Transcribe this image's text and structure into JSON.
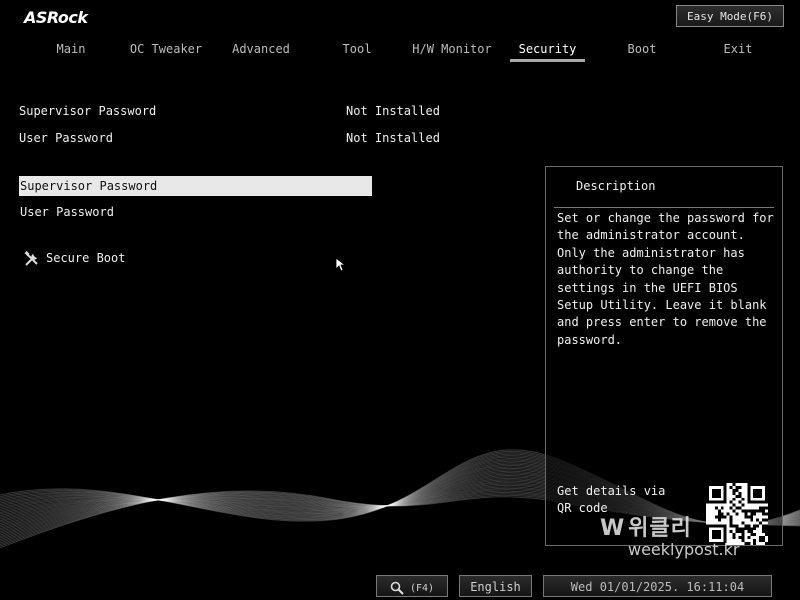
{
  "header": {
    "logo": "ASRock",
    "easy_mode_label": "Easy Mode(F6)"
  },
  "tabs": [
    {
      "label": "Main"
    },
    {
      "label": "OC Tweaker"
    },
    {
      "label": "Advanced"
    },
    {
      "label": "Tool"
    },
    {
      "label": "H/W Monitor"
    },
    {
      "label": "Security",
      "active": true
    },
    {
      "label": "Boot"
    },
    {
      "label": "Exit"
    }
  ],
  "status": {
    "supervisor_label": "Supervisor Password",
    "supervisor_value": "Not Installed",
    "user_label": "User Password",
    "user_value": "Not Installed"
  },
  "menu": {
    "items": [
      {
        "label": "Supervisor Password",
        "selected": true
      },
      {
        "label": "User Password"
      }
    ],
    "secure_boot_label": "Secure Boot",
    "secure_boot_icon": "tools-icon"
  },
  "description": {
    "title": "Description",
    "text": "Set or change the password for the administrator account. Only the administrator has authority to change the settings in the UEFI BIOS Setup Utility. Leave it blank and press enter to remove the password.",
    "qr_text": "Get details via QR code"
  },
  "watermark": {
    "korean": "위클리",
    "url": "weeklypost.kr"
  },
  "footer": {
    "search_key": "(F4)",
    "language": "English",
    "datetime": "Wed 01/01/2025. 16:11:04"
  },
  "colors": {
    "background": "#000000",
    "selected_bg": "#e8e8e8",
    "text": "#f0f0f0"
  }
}
